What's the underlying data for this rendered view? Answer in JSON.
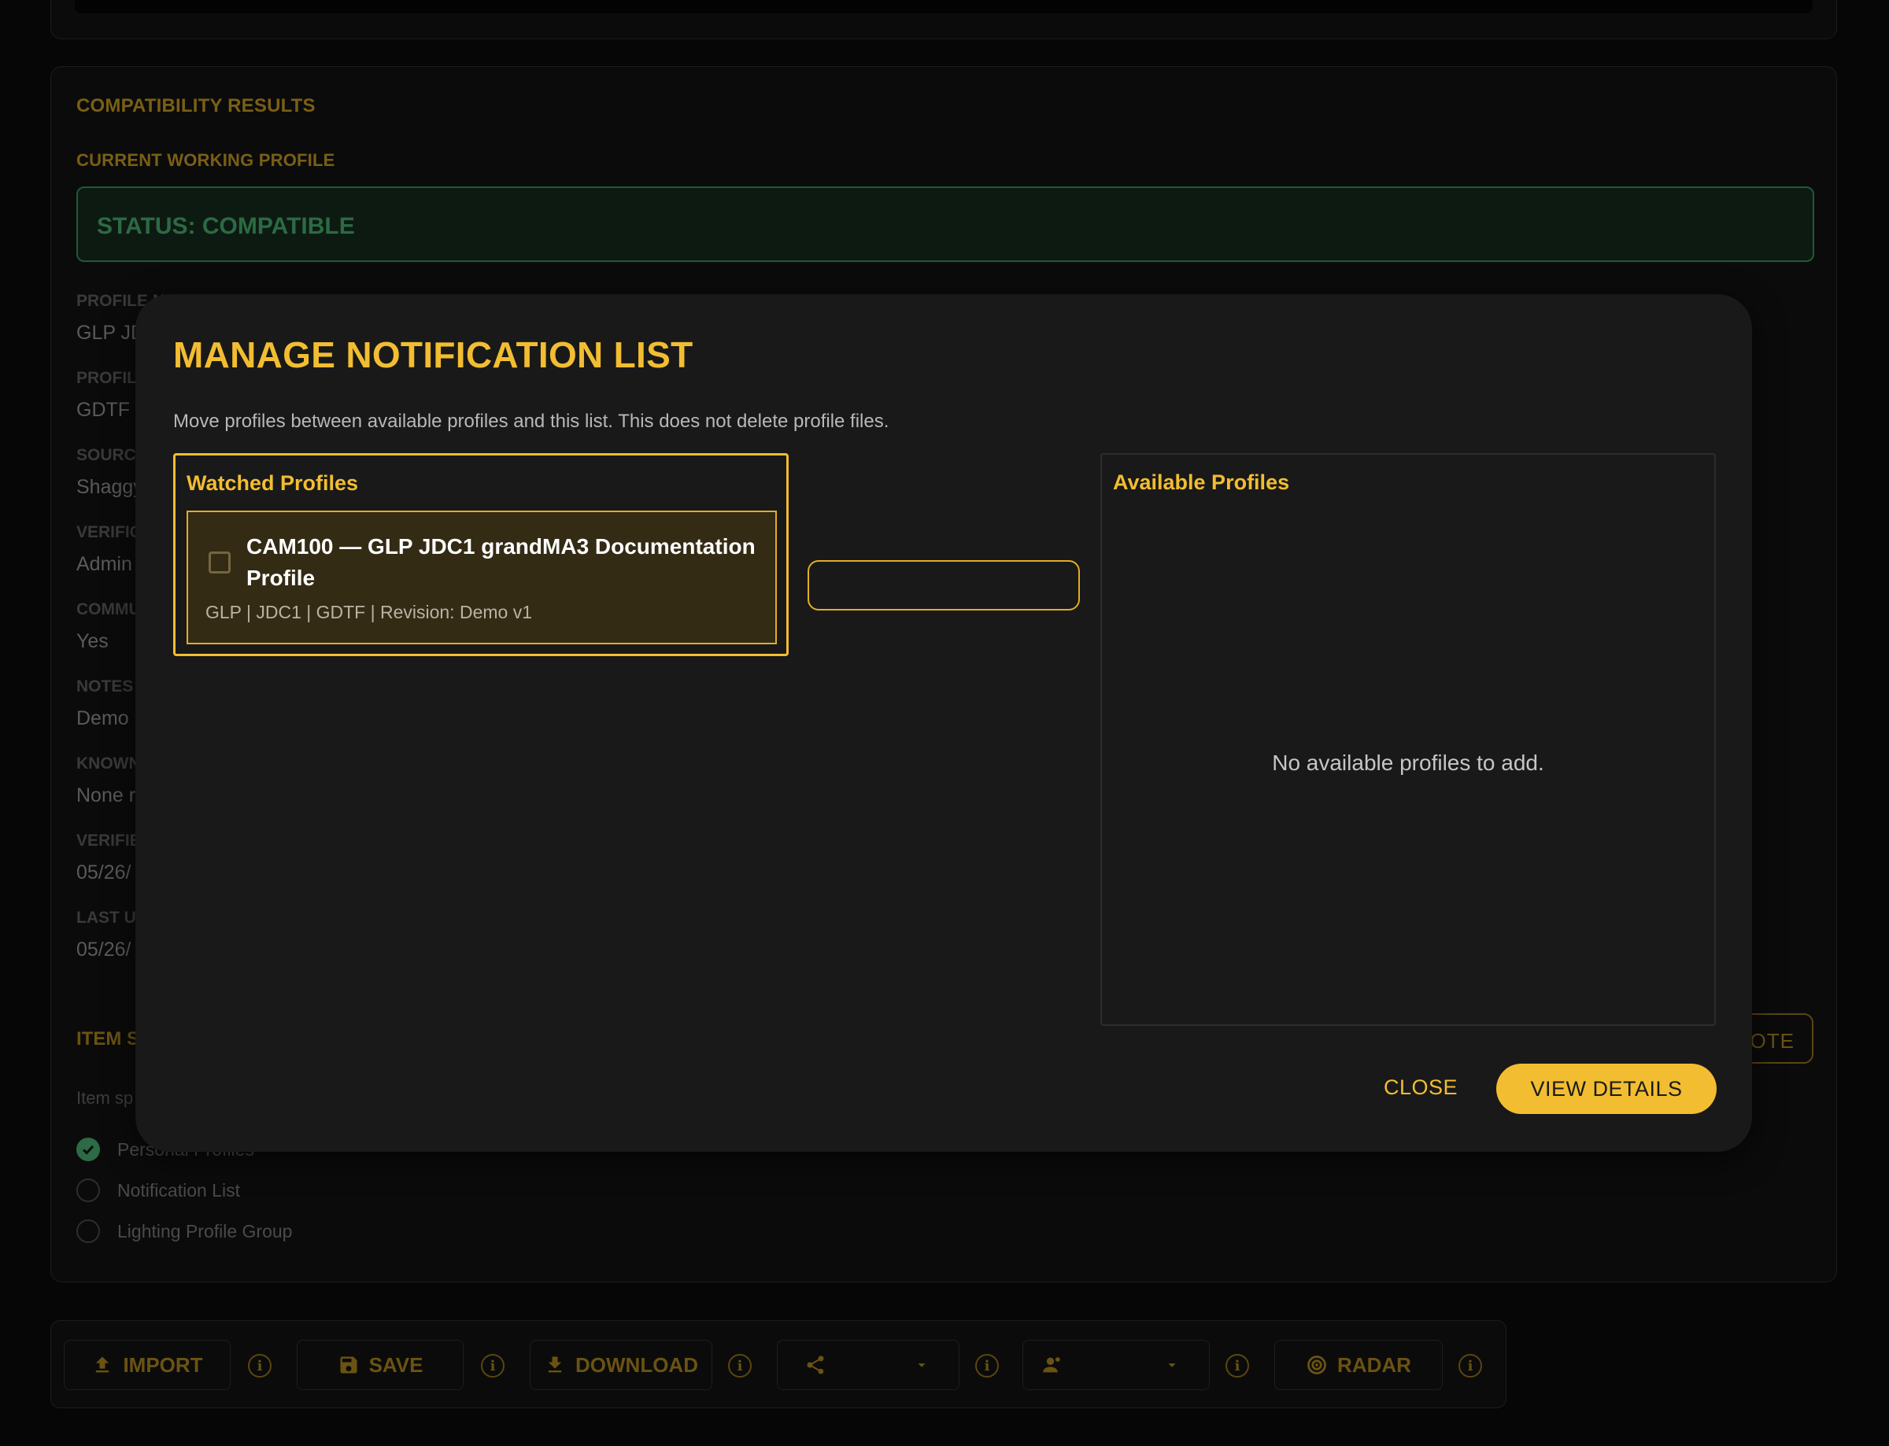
{
  "background": {
    "results_title": "COMPATIBILITY RESULTS",
    "working_profile_label": "CURRENT WORKING PROFILE",
    "status_text": "STATUS: COMPATIBLE",
    "fields": [
      {
        "label": "PROFILE NAME",
        "value": "GLP JDC1"
      },
      {
        "label": "PROFILE",
        "value": "GDTF"
      },
      {
        "label": "SOURCE",
        "value": "Shaggy"
      },
      {
        "label": "VERIFIC",
        "value": "Admin"
      },
      {
        "label": "COMMU",
        "value": "Yes"
      },
      {
        "label": "NOTES",
        "value": "Demo"
      },
      {
        "label": "KNOWN",
        "value": "None r"
      },
      {
        "label": "VERIFIE",
        "value": "05/26/"
      },
      {
        "label": "LAST UI",
        "value": "05/26/"
      }
    ],
    "item_section_title": "ITEM S",
    "item_section_desc": "Item sp",
    "options": [
      {
        "label": "Personal Profiles",
        "checked": true
      },
      {
        "label": "Notification List",
        "checked": false
      },
      {
        "label": "Lighting Profile Group",
        "checked": false
      }
    ],
    "note_button_label": "OTE"
  },
  "toolbar": {
    "import_label": "IMPORT",
    "save_label": "SAVE",
    "download_label": "DOWNLOAD",
    "radar_label": "RADAR",
    "info_symbol": "i"
  },
  "modal": {
    "title": "MANAGE NOTIFICATION LIST",
    "description": "Move profiles between available profiles and this list. This does not delete profile files.",
    "watched_title": "Watched Profiles",
    "watched_profiles": [
      {
        "title": "CAM100 — GLP JDC1 grandMA3 Documentation Profile",
        "meta": "GLP | JDC1 | GDTF | Revision: Demo v1"
      }
    ],
    "available_title": "Available Profiles",
    "available_empty": "No available profiles to add.",
    "close_label": "CLOSE",
    "view_details_label": "VIEW DETAILS"
  },
  "colors": {
    "accent": "#f2bd31",
    "modal_bg": "#191919",
    "page_bg": "#060606",
    "status_green": "#2c6a44"
  }
}
